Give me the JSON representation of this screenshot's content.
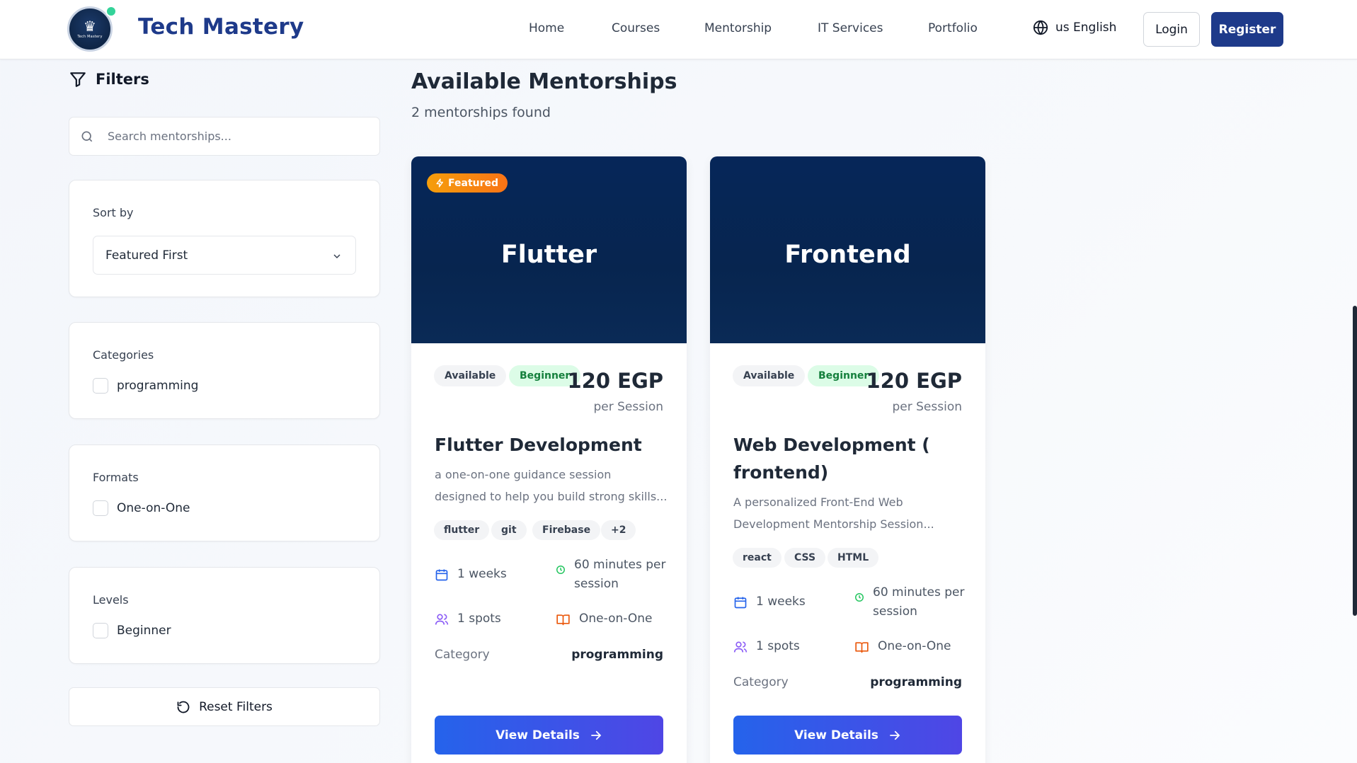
{
  "header": {
    "brand": "Tech Mastery",
    "logo_text": "Tech Mastery",
    "nav": [
      "Home",
      "Courses",
      "Mentorship",
      "IT Services",
      "Portfolio"
    ],
    "language": "us English",
    "login": "Login",
    "register": "Register"
  },
  "sidebar": {
    "title": "Filters",
    "search_placeholder": "Search mentorships...",
    "sort": {
      "label": "Sort by",
      "value": "Featured First"
    },
    "categories": {
      "label": "Categories",
      "options": [
        "programming"
      ]
    },
    "formats": {
      "label": "Formats",
      "options": [
        "One-on-One"
      ]
    },
    "levels": {
      "label": "Levels",
      "options": [
        "Beginner"
      ]
    },
    "reset": "Reset Filters"
  },
  "main": {
    "title": "Available Mentorships",
    "count_text": "2 mentorships found",
    "cards": [
      {
        "hero": "Flutter",
        "featured": "Featured",
        "status": "Available",
        "level": "Beginner",
        "price": "120 EGP",
        "per": "per Session",
        "title": "Flutter Development",
        "desc1": "a one-on-one guidance session",
        "desc2": "designed to help you build strong skills...",
        "tags": [
          "flutter",
          "git",
          "Firebase",
          "+2"
        ],
        "duration": "1 weeks",
        "session1": "60 minutes per",
        "session2": "session",
        "spots": "1 spots",
        "format": "One-on-One",
        "category_label": "Category",
        "category": "programming",
        "button": "View Details"
      },
      {
        "hero": "Frontend",
        "status": "Available",
        "level": "Beginner",
        "price": "120 EGP",
        "per": "per Session",
        "title1": "Web Development (",
        "title2": "frontend)",
        "desc1": "A personalized Front-End Web",
        "desc2": "Development Mentorship Session...",
        "tags": [
          "react",
          "CSS",
          "HTML"
        ],
        "duration": "1 weeks",
        "session1": "60 minutes per",
        "session2": "session",
        "spots": "1 spots",
        "format": "One-on-One",
        "category_label": "Category",
        "category": "programming",
        "button": "View Details"
      }
    ]
  },
  "colors": {
    "brand": "#1e3a8a",
    "hero": "#062659",
    "button_start": "#2563eb",
    "button_end": "#4f46e5",
    "featured": "#f59e0b"
  }
}
